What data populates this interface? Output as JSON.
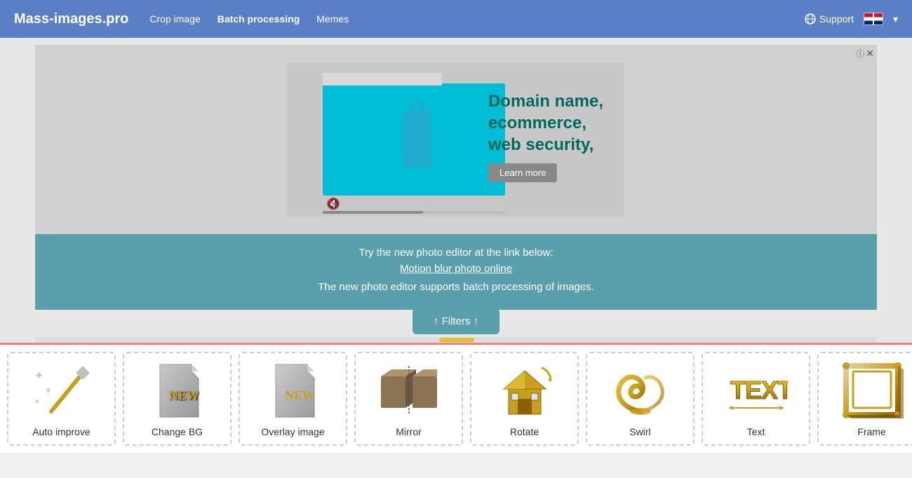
{
  "navbar": {
    "brand": "Mass-images.pro",
    "links": [
      {
        "label": "Crop image",
        "active": false
      },
      {
        "label": "Batch processing",
        "active": true
      },
      {
        "label": "Memes",
        "active": false
      }
    ],
    "support_label": "Support",
    "flag_alt": "English"
  },
  "ad": {
    "headline": "Domain name,\necommerce,\nweb security,",
    "learn_more": "Learn more",
    "close": "×",
    "info": "ⓘ"
  },
  "info_banner": {
    "line1": "Try the new photo editor at the link below:",
    "link": "Motion blur photo online",
    "line2": "The new photo editor supports batch processing of images."
  },
  "filters_button": {
    "label": "↑ Filters ↑"
  },
  "tools": [
    {
      "label": "Auto improve",
      "icon": "wand",
      "new": false
    },
    {
      "label": "Change BG",
      "icon": "changeBG",
      "new": true
    },
    {
      "label": "Overlay image",
      "icon": "overlay",
      "new": true
    },
    {
      "label": "Mirror",
      "icon": "mirror",
      "new": false
    },
    {
      "label": "Rotate",
      "icon": "rotate",
      "new": false
    },
    {
      "label": "Swirl",
      "icon": "swirl",
      "new": false
    },
    {
      "label": "Text",
      "icon": "text-icon",
      "new": false
    },
    {
      "label": "Frame",
      "icon": "frame",
      "new": false
    }
  ]
}
